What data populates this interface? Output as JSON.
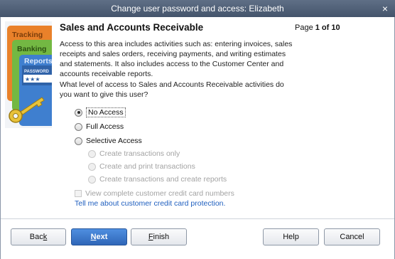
{
  "window": {
    "title": "Change user password and access: Elizabeth",
    "close_glyph": "×"
  },
  "illustration": {
    "cards": [
      "Tracking",
      "Banking",
      "Reports"
    ],
    "password_label": "PASSWORD",
    "password_mask": "★★★",
    "colors": {
      "tracking": "#e9812a",
      "banking": "#73b843",
      "reports": "#3f7fcf",
      "key": "#e8c23a"
    }
  },
  "header": {
    "title": "Sales and Accounts Receivable",
    "page_prefix": "Page ",
    "page_value": "1 of 10"
  },
  "description": "Access to this area includes activities such as: entering invoices, sales receipts and sales orders, receiving payments, and writing estimates and statements. It also includes access to the Customer Center and accounts receivable reports.",
  "question": "What level of access to Sales and Accounts Receivable activities do you want to give this user?",
  "access_options": {
    "no_access": "No Access",
    "full_access": "Full Access",
    "selective_access": "Selective Access",
    "selected": "No Access"
  },
  "selective_options": [
    "Create transactions only",
    "Create and print transactions",
    "Create transactions and create reports"
  ],
  "credit_card_checkbox": "View complete customer credit card numbers",
  "help_link": "Tell me about customer credit card protection.",
  "buttons": {
    "back_pre": "Bac",
    "back_ul": "k",
    "back_post": "",
    "next_pre": "",
    "next_ul": "N",
    "next_post": "ext",
    "finish_pre": "",
    "finish_ul": "F",
    "finish_post": "inish",
    "help": "Help",
    "cancel": "Cancel"
  },
  "colors": {
    "titlebar": "#4f5f76",
    "primary_button": "#2f66b8",
    "link": "#1f5fbf"
  }
}
